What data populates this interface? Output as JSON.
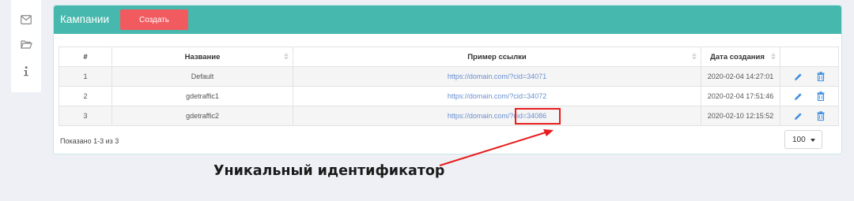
{
  "sidebar": {
    "items": [
      {
        "icon": "envelope-icon"
      },
      {
        "icon": "folder-icon"
      },
      {
        "icon": "info-icon"
      }
    ]
  },
  "panel": {
    "title": "Кампании",
    "create_label": "Создать",
    "header_color": "#47b8ad",
    "button_color": "#f15a5f"
  },
  "table": {
    "columns": [
      "#",
      "Название",
      "Пример ссылки",
      "Дата создания",
      ""
    ],
    "rows": [
      {
        "num": "1",
        "name": "Default",
        "link": "https://domain.com/?cid=34071",
        "date": "2020-02-04 14:27:01"
      },
      {
        "num": "2",
        "name": "gdetraffic1",
        "link": "https://domain.com/?cid=34072",
        "date": "2020-02-04 17:51:46"
      },
      {
        "num": "3",
        "name": "gdetraffic2",
        "link": "https://domain.com/?cid=34086",
        "date": "2020-02-10 12:15:52"
      }
    ]
  },
  "footer": {
    "shown_text": "Показано 1-3 из 3",
    "page_size": "100"
  },
  "annotation": {
    "label": "Уникальный идентификатор",
    "color": "#e81c1c"
  }
}
